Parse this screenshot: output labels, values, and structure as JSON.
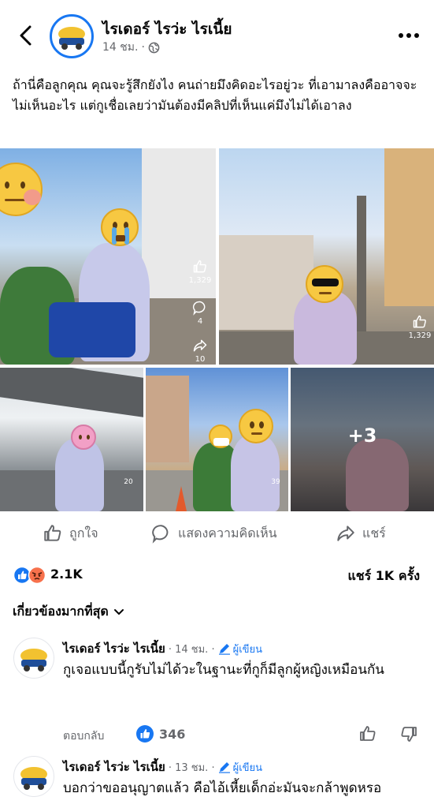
{
  "header": {
    "page_name": "ไรเดอร์ ไรว่ะ ไรเนี้ย",
    "timestamp": "14 ชม.",
    "separator": "·",
    "logo_text": "ไรเดอร์"
  },
  "post": {
    "text": "ถ้านี่คือลูกคุณ คุณจะรู้สึกยังไง คนถ่ายมึงคิดอะไรอยู่วะ ที่เอามาลงคืออาจจะไม่เห็นอะไร แต่กูเชื่อเลยว่ามันต้องมีคลิปที่เห็นแค่มึงไม่ได้เอาลง"
  },
  "photos": {
    "p1_likes": "1,329",
    "p1_comments": "4",
    "p1_shares": "10",
    "p2_likes": "1,329",
    "p3_comments": "20",
    "p4_comments": "39",
    "more_count": "+3"
  },
  "actions": {
    "like": "ถูกใจ",
    "comment": "แสดงความคิดเห็น",
    "share": "แชร์"
  },
  "stats": {
    "reactions": "2.1K",
    "shares": "แชร์ 1K ครั้ง"
  },
  "sort_label": "เกี่ยวข้องมากที่สุด",
  "comments": [
    {
      "author": "ไรเดอร์ ไรว่ะ ไรเนี้ย",
      "time": "· 14 ชม. ·",
      "badge": "ผู้เขียน",
      "text": "กูเจอแบบนี้กูรับไม่ได้วะในฐานะที่กูก็มีลูกผู้หญิงเหมือนกัน",
      "reply": "ตอบกลับ",
      "likes": "346"
    },
    {
      "author": "ไรเดอร์ ไรว่ะ ไรเนี้ย",
      "time": "· 13 ชม. ·",
      "badge": "ผู้เขียน",
      "text": "บอกว่าขออนุญาตแล้ว คือไอ้เหี้ยเด็กอ่ะมันจะกล้าพูดหรอ"
    }
  ],
  "colors": {
    "accent": "#1877f2",
    "secondary_text": "#65676b",
    "love_red": "#f33e58",
    "angry_orange": "#f7714c"
  }
}
